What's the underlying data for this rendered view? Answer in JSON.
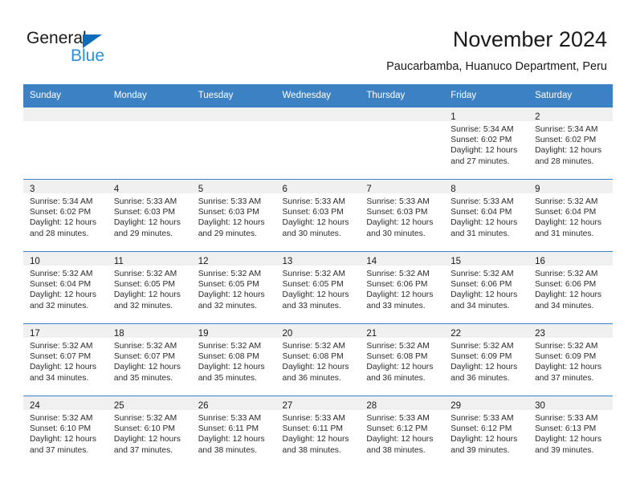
{
  "brand": {
    "name_part1": "General",
    "name_part2": "Blue",
    "logo_icon": "triangle-logo-icon"
  },
  "header": {
    "title": "November 2024",
    "subtitle": "Paucarbamba, Huanuco Department, Peru"
  },
  "colors": {
    "header_blue": "#3c81c4",
    "brand_blue": "#2e8fd6",
    "logo_blue": "#0d6cb9",
    "daynum_band": "#f0f0f0"
  },
  "calendar": {
    "weekday_headers": [
      "Sunday",
      "Monday",
      "Tuesday",
      "Wednesday",
      "Thursday",
      "Friday",
      "Saturday"
    ],
    "weeks": [
      [
        {
          "day": "",
          "empty": true
        },
        {
          "day": "",
          "empty": true
        },
        {
          "day": "",
          "empty": true
        },
        {
          "day": "",
          "empty": true
        },
        {
          "day": "",
          "empty": true
        },
        {
          "day": "1",
          "sunrise": "Sunrise: 5:34 AM",
          "sunset": "Sunset: 6:02 PM",
          "daylight": "Daylight: 12 hours and 27 minutes."
        },
        {
          "day": "2",
          "sunrise": "Sunrise: 5:34 AM",
          "sunset": "Sunset: 6:02 PM",
          "daylight": "Daylight: 12 hours and 28 minutes."
        }
      ],
      [
        {
          "day": "3",
          "sunrise": "Sunrise: 5:34 AM",
          "sunset": "Sunset: 6:02 PM",
          "daylight": "Daylight: 12 hours and 28 minutes."
        },
        {
          "day": "4",
          "sunrise": "Sunrise: 5:33 AM",
          "sunset": "Sunset: 6:03 PM",
          "daylight": "Daylight: 12 hours and 29 minutes."
        },
        {
          "day": "5",
          "sunrise": "Sunrise: 5:33 AM",
          "sunset": "Sunset: 6:03 PM",
          "daylight": "Daylight: 12 hours and 29 minutes."
        },
        {
          "day": "6",
          "sunrise": "Sunrise: 5:33 AM",
          "sunset": "Sunset: 6:03 PM",
          "daylight": "Daylight: 12 hours and 30 minutes."
        },
        {
          "day": "7",
          "sunrise": "Sunrise: 5:33 AM",
          "sunset": "Sunset: 6:03 PM",
          "daylight": "Daylight: 12 hours and 30 minutes."
        },
        {
          "day": "8",
          "sunrise": "Sunrise: 5:33 AM",
          "sunset": "Sunset: 6:04 PM",
          "daylight": "Daylight: 12 hours and 31 minutes."
        },
        {
          "day": "9",
          "sunrise": "Sunrise: 5:32 AM",
          "sunset": "Sunset: 6:04 PM",
          "daylight": "Daylight: 12 hours and 31 minutes."
        }
      ],
      [
        {
          "day": "10",
          "sunrise": "Sunrise: 5:32 AM",
          "sunset": "Sunset: 6:04 PM",
          "daylight": "Daylight: 12 hours and 32 minutes."
        },
        {
          "day": "11",
          "sunrise": "Sunrise: 5:32 AM",
          "sunset": "Sunset: 6:05 PM",
          "daylight": "Daylight: 12 hours and 32 minutes."
        },
        {
          "day": "12",
          "sunrise": "Sunrise: 5:32 AM",
          "sunset": "Sunset: 6:05 PM",
          "daylight": "Daylight: 12 hours and 32 minutes."
        },
        {
          "day": "13",
          "sunrise": "Sunrise: 5:32 AM",
          "sunset": "Sunset: 6:05 PM",
          "daylight": "Daylight: 12 hours and 33 minutes."
        },
        {
          "day": "14",
          "sunrise": "Sunrise: 5:32 AM",
          "sunset": "Sunset: 6:06 PM",
          "daylight": "Daylight: 12 hours and 33 minutes."
        },
        {
          "day": "15",
          "sunrise": "Sunrise: 5:32 AM",
          "sunset": "Sunset: 6:06 PM",
          "daylight": "Daylight: 12 hours and 34 minutes."
        },
        {
          "day": "16",
          "sunrise": "Sunrise: 5:32 AM",
          "sunset": "Sunset: 6:06 PM",
          "daylight": "Daylight: 12 hours and 34 minutes."
        }
      ],
      [
        {
          "day": "17",
          "sunrise": "Sunrise: 5:32 AM",
          "sunset": "Sunset: 6:07 PM",
          "daylight": "Daylight: 12 hours and 34 minutes."
        },
        {
          "day": "18",
          "sunrise": "Sunrise: 5:32 AM",
          "sunset": "Sunset: 6:07 PM",
          "daylight": "Daylight: 12 hours and 35 minutes."
        },
        {
          "day": "19",
          "sunrise": "Sunrise: 5:32 AM",
          "sunset": "Sunset: 6:08 PM",
          "daylight": "Daylight: 12 hours and 35 minutes."
        },
        {
          "day": "20",
          "sunrise": "Sunrise: 5:32 AM",
          "sunset": "Sunset: 6:08 PM",
          "daylight": "Daylight: 12 hours and 36 minutes."
        },
        {
          "day": "21",
          "sunrise": "Sunrise: 5:32 AM",
          "sunset": "Sunset: 6:08 PM",
          "daylight": "Daylight: 12 hours and 36 minutes."
        },
        {
          "day": "22",
          "sunrise": "Sunrise: 5:32 AM",
          "sunset": "Sunset: 6:09 PM",
          "daylight": "Daylight: 12 hours and 36 minutes."
        },
        {
          "day": "23",
          "sunrise": "Sunrise: 5:32 AM",
          "sunset": "Sunset: 6:09 PM",
          "daylight": "Daylight: 12 hours and 37 minutes."
        }
      ],
      [
        {
          "day": "24",
          "sunrise": "Sunrise: 5:32 AM",
          "sunset": "Sunset: 6:10 PM",
          "daylight": "Daylight: 12 hours and 37 minutes."
        },
        {
          "day": "25",
          "sunrise": "Sunrise: 5:32 AM",
          "sunset": "Sunset: 6:10 PM",
          "daylight": "Daylight: 12 hours and 37 minutes."
        },
        {
          "day": "26",
          "sunrise": "Sunrise: 5:33 AM",
          "sunset": "Sunset: 6:11 PM",
          "daylight": "Daylight: 12 hours and 38 minutes."
        },
        {
          "day": "27",
          "sunrise": "Sunrise: 5:33 AM",
          "sunset": "Sunset: 6:11 PM",
          "daylight": "Daylight: 12 hours and 38 minutes."
        },
        {
          "day": "28",
          "sunrise": "Sunrise: 5:33 AM",
          "sunset": "Sunset: 6:12 PM",
          "daylight": "Daylight: 12 hours and 38 minutes."
        },
        {
          "day": "29",
          "sunrise": "Sunrise: 5:33 AM",
          "sunset": "Sunset: 6:12 PM",
          "daylight": "Daylight: 12 hours and 39 minutes."
        },
        {
          "day": "30",
          "sunrise": "Sunrise: 5:33 AM",
          "sunset": "Sunset: 6:13 PM",
          "daylight": "Daylight: 12 hours and 39 minutes."
        }
      ]
    ]
  }
}
